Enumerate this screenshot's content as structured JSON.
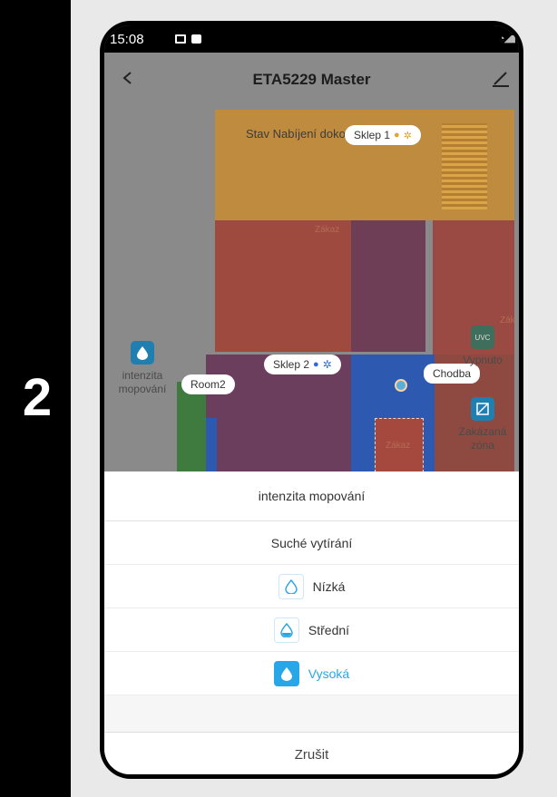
{
  "step": {
    "number": "2"
  },
  "status_bar": {
    "time": "15:08",
    "icons": [
      "image-icon",
      "video-icon",
      "wifi-icon",
      "signal-icon",
      "battery-icon"
    ]
  },
  "header": {
    "title": "ETA5229 Master"
  },
  "map": {
    "status_text": "Stav Nabíjení dokončeno",
    "rooms": {
      "sklep1": "Sklep 1",
      "sklep2": "Sklep 2",
      "room2": "Room2",
      "chodba": "Chodba"
    },
    "zones": {
      "zakaz_1": "Zákaz",
      "zakaz_2": "Zákaz",
      "zakaz_3": "Zák"
    },
    "tools": {
      "mop_intensity": {
        "line1": "intenzita",
        "line2": "mopování"
      },
      "uvc": {
        "badge": "UVC",
        "label": "Vypnuto"
      },
      "forbidden_zone": {
        "line1": "Zakázaná",
        "line2": "zóna"
      }
    }
  },
  "sheet": {
    "title": "intenzita mopování",
    "options": [
      {
        "label": "Suché vytírání",
        "selected": false
      },
      {
        "label": "Nízká",
        "selected": false
      },
      {
        "label": "Střední",
        "selected": false
      },
      {
        "label": "Vysoká",
        "selected": true
      }
    ],
    "cancel": "Zrušit"
  },
  "colors": {
    "accent": "#27a7e7",
    "map_orange": "#e0a84c",
    "map_red": "#c85a4c",
    "map_blue": "#2d60c4",
    "map_purple": "#7a4a6c",
    "map_green": "#4e8a4c"
  }
}
